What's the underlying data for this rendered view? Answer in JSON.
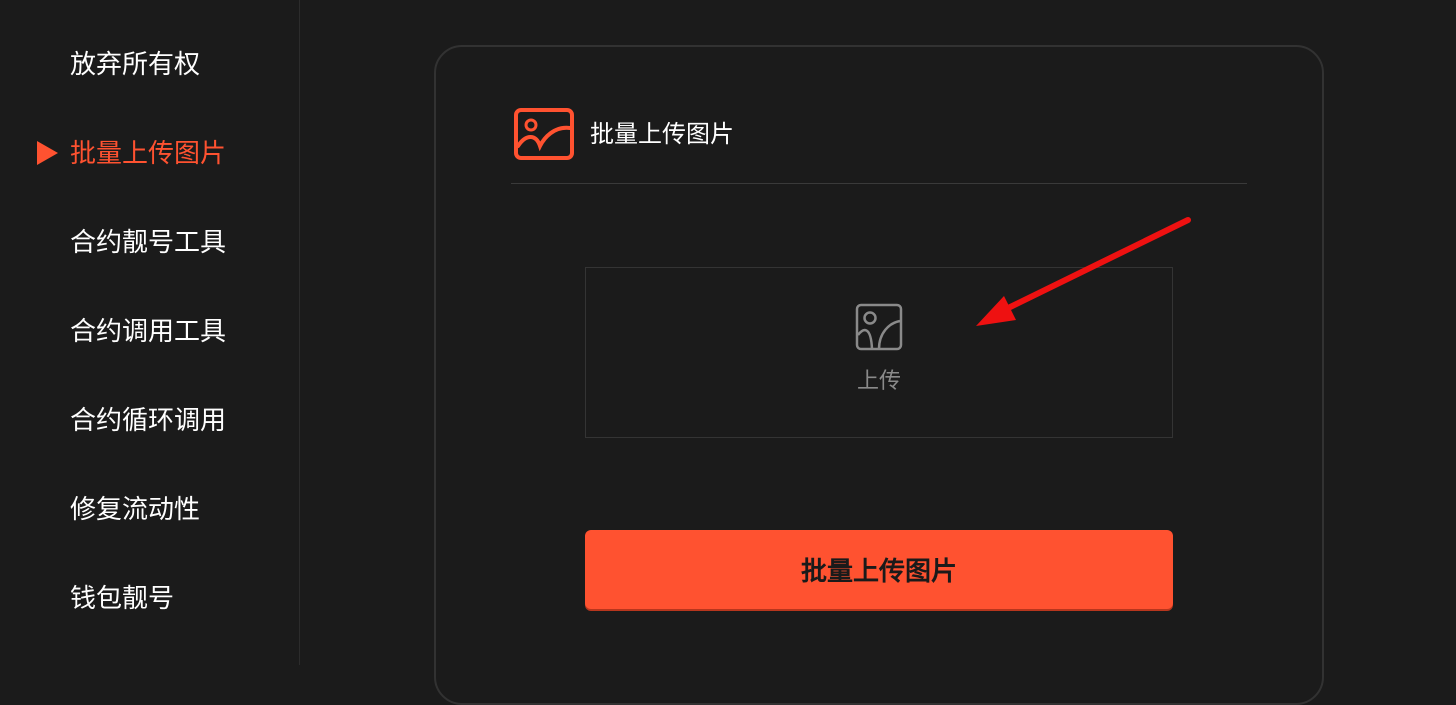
{
  "sidebar": {
    "items": [
      {
        "label": "放弃所有权",
        "active": false
      },
      {
        "label": "批量上传图片",
        "active": true
      },
      {
        "label": "合约靓号工具",
        "active": false
      },
      {
        "label": "合约调用工具",
        "active": false
      },
      {
        "label": "合约循环调用",
        "active": false
      },
      {
        "label": "修复流动性",
        "active": false
      },
      {
        "label": "钱包靓号",
        "active": false
      }
    ]
  },
  "card": {
    "title": "批量上传图片",
    "header_icon": "image-icon",
    "upload": {
      "icon": "image-icon",
      "label": "上传"
    },
    "submit_label": "批量上传图片"
  },
  "colors": {
    "background": "#1b1b1b",
    "accent": "#ff5230",
    "text": "#ffffff",
    "muted_text": "#8a8a8a",
    "annotation_arrow": "#ee1111"
  }
}
